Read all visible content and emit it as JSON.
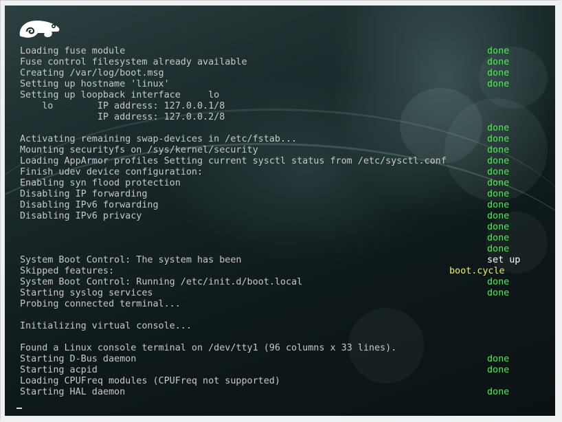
{
  "console": {
    "lines": [
      {
        "msg": "Loading fuse module",
        "status": "done",
        "status_type": "done"
      },
      {
        "msg": "Fuse control filesystem already available",
        "status": "done",
        "status_type": "done"
      },
      {
        "msg": "Creating /var/log/boot.msg",
        "status": "done",
        "status_type": "done"
      },
      {
        "msg": "Setting up hostname 'linux'",
        "status": "done",
        "status_type": "done"
      },
      {
        "msg": "Setting up loopback interface     lo",
        "status": "",
        "status_type": "none"
      },
      {
        "msg": "    lo        IP address: 127.0.0.1/8",
        "status": "",
        "status_type": "none"
      },
      {
        "msg": "              IP address: 127.0.0.2/8",
        "status": "",
        "status_type": "none"
      },
      {
        "msg": "",
        "status": "done",
        "status_type": "done"
      },
      {
        "msg": "Activating remaining swap-devices in /etc/fstab...",
        "status": "done",
        "status_type": "done"
      },
      {
        "msg": "Mounting securityfs on /sys/kernel/security",
        "status": "done",
        "status_type": "done"
      },
      {
        "msg": "Loading AppArmor profiles Setting current sysctl status from /etc/sysctl.conf",
        "status": "done",
        "status_type": "done"
      },
      {
        "msg": "Finish udev device configuration:",
        "status": "done",
        "status_type": "done"
      },
      {
        "msg": "Enabling syn flood protection",
        "status": "done",
        "status_type": "done"
      },
      {
        "msg": "Disabling IP forwarding",
        "status": "done",
        "status_type": "done"
      },
      {
        "msg": "Disabling IPv6 forwarding",
        "status": "done",
        "status_type": "done"
      },
      {
        "msg": "Disabling IPv6 privacy",
        "status": "done",
        "status_type": "done"
      },
      {
        "msg": "",
        "status": "done",
        "status_type": "done"
      },
      {
        "msg": "",
        "status": "done",
        "status_type": "done"
      },
      {
        "msg": "",
        "status": "done",
        "status_type": "done"
      },
      {
        "msg": "System Boot Control: The system has been",
        "status": "set up",
        "status_type": "setup"
      },
      {
        "msg": "Skipped features:",
        "status": "boot.cycle",
        "status_type": "boot"
      },
      {
        "msg": "System Boot Control: Running /etc/init.d/boot.local",
        "status": "done",
        "status_type": "done"
      },
      {
        "msg": "Starting syslog services",
        "status": "done",
        "status_type": "done"
      },
      {
        "msg": "Probing connected terminal...",
        "status": "",
        "status_type": "none"
      },
      {
        "msg": "",
        "status": "",
        "status_type": "none"
      },
      {
        "msg": "Initializing virtual console...",
        "status": "",
        "status_type": "none"
      },
      {
        "msg": "",
        "status": "",
        "status_type": "none"
      },
      {
        "msg": "Found a Linux console terminal on /dev/tty1 (96 columns x 33 lines).",
        "status": "",
        "status_type": "none"
      },
      {
        "msg": "Starting D-Bus daemon",
        "status": "done",
        "status_type": "done"
      },
      {
        "msg": "Starting acpid",
        "status": "done",
        "status_type": "done"
      },
      {
        "msg": "Loading CPUFreq modules (CPUFreq not supported)",
        "status": "",
        "status_type": "none"
      },
      {
        "msg": "Starting HAL daemon",
        "status": "done",
        "status_type": "done"
      }
    ]
  },
  "icons": {
    "logo": "suse-chameleon-logo",
    "cursor": "text-cursor"
  },
  "colors": {
    "done": "#4cf04c",
    "set_up": "#ffffff",
    "boot_cycle": "#f0f04c",
    "text": "#c8c8c8"
  }
}
